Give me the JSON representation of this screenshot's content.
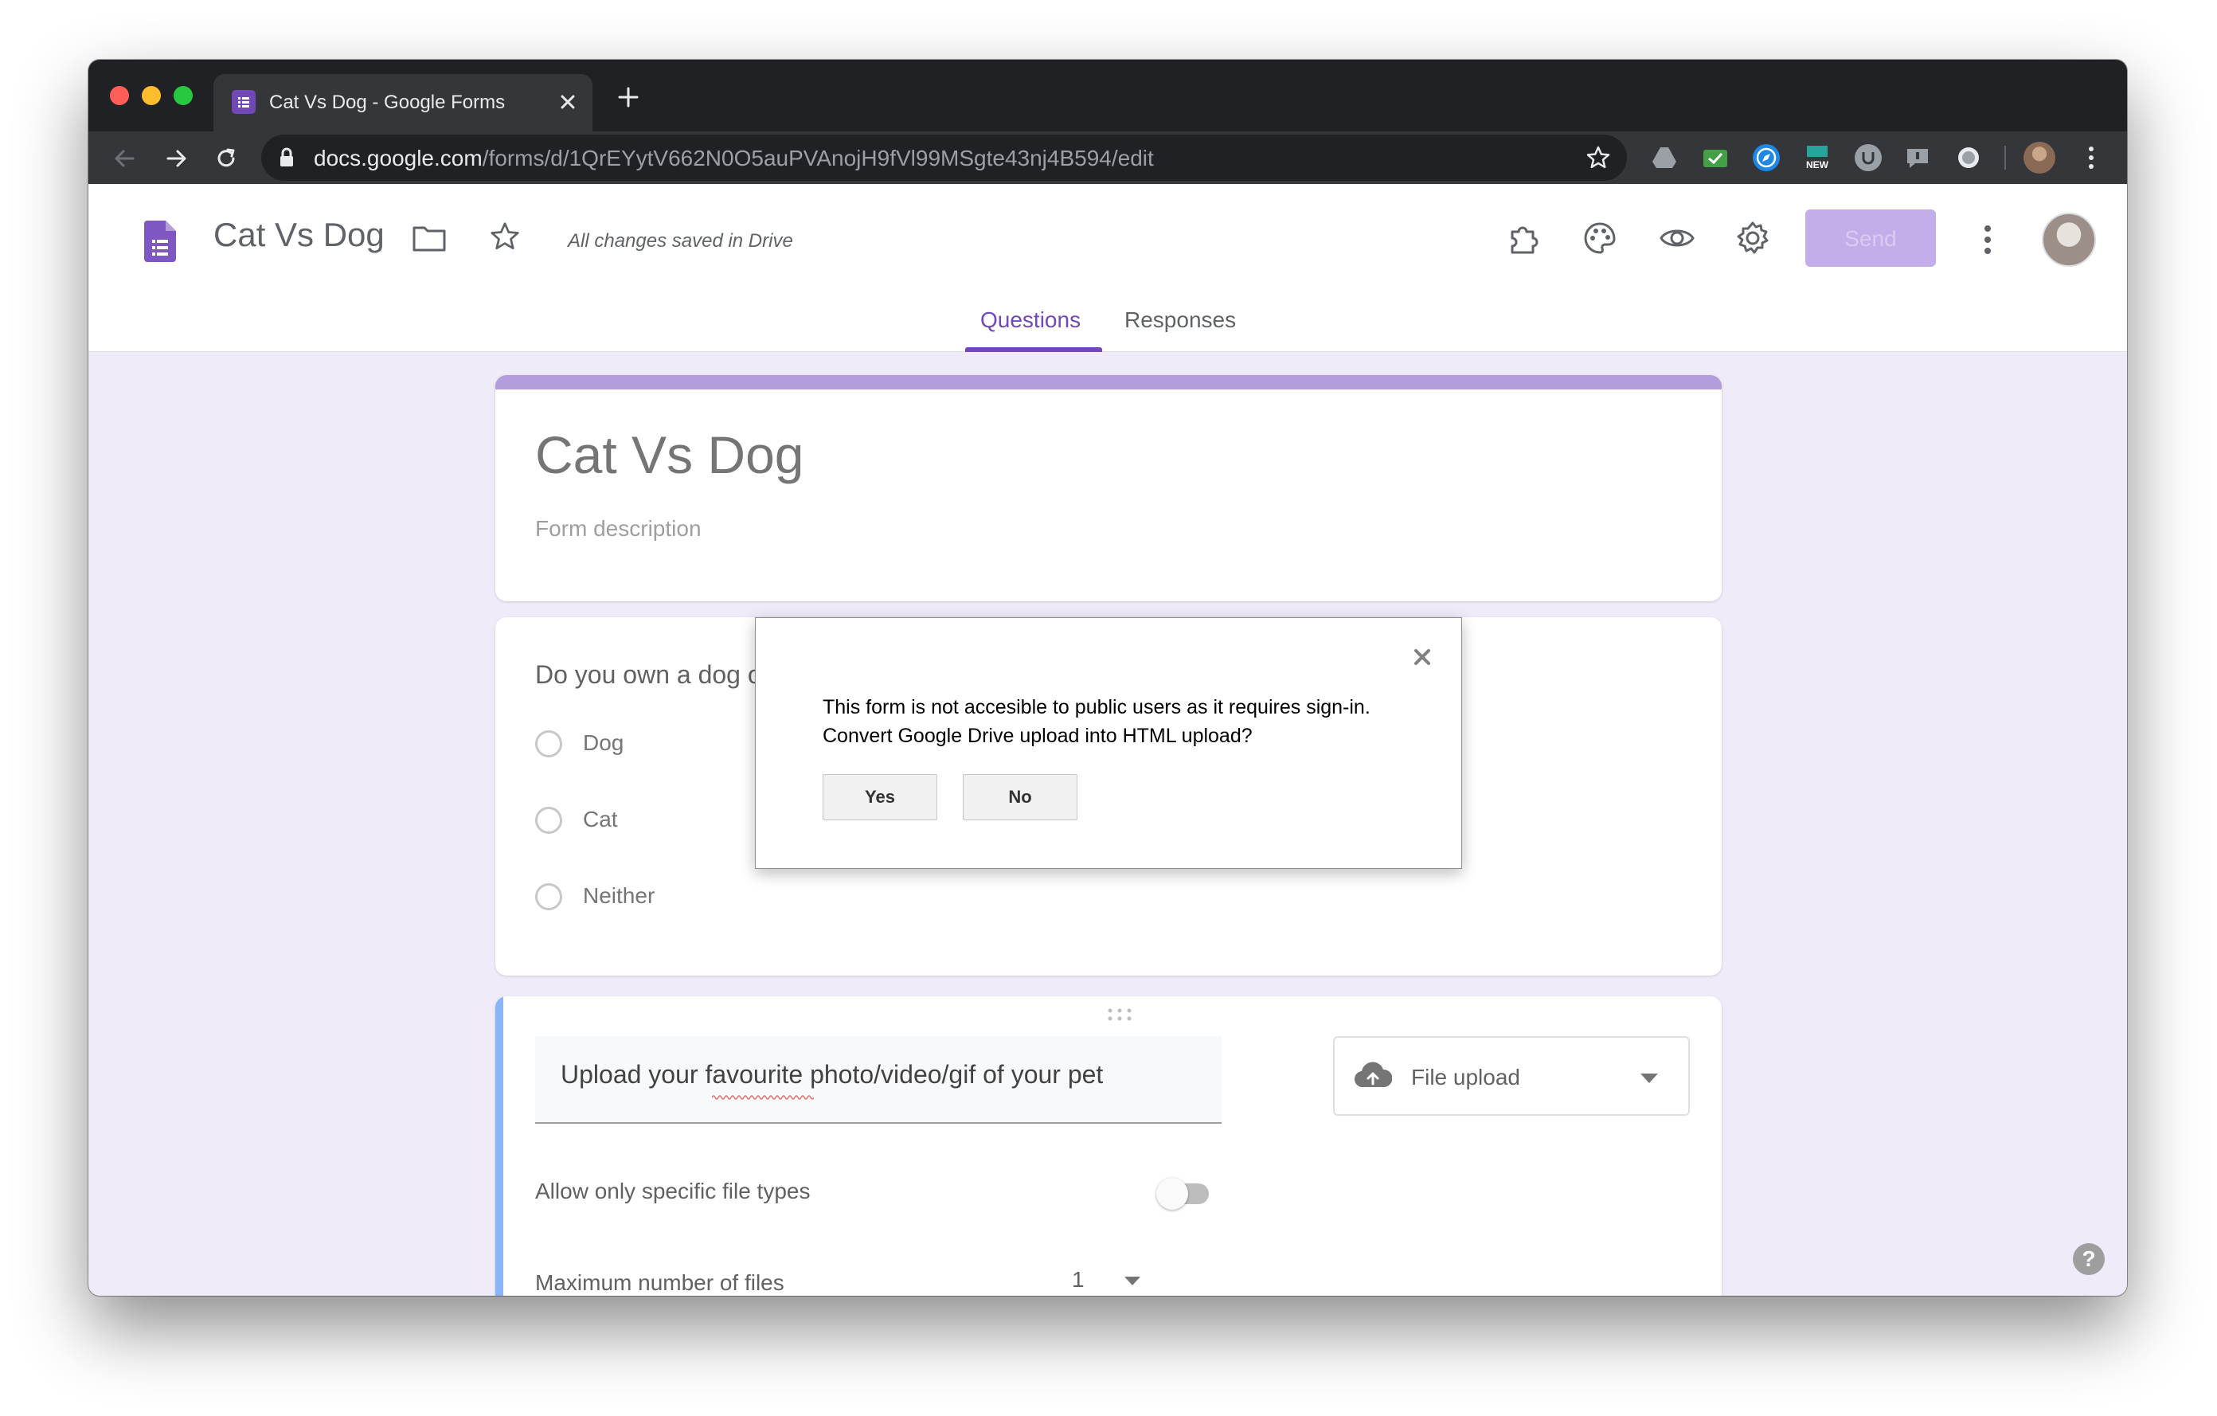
{
  "browser": {
    "tab_title": "Cat Vs Dog - Google Forms",
    "url_host": "docs.google.com",
    "url_path": "/forms/d/1QrEYytV662N0O5auPVAnojH9fVl99MSgte43nj4B594/edit",
    "extensions": [
      "google-drive-icon",
      "mail-check-icon",
      "compass-icon",
      "new-badge-icon",
      "u-extension-icon",
      "feedback-extension-icon",
      "record-extension-icon"
    ]
  },
  "header": {
    "doc_title": "Cat Vs Dog",
    "save_status": "All changes saved in Drive",
    "send_label": "Send",
    "tabs": [
      {
        "label": "Questions",
        "active": true
      },
      {
        "label": "Responses",
        "active": false
      }
    ]
  },
  "form": {
    "title": "Cat Vs Dog",
    "description_placeholder": "Form description",
    "question1": {
      "text": "Do you own a dog o",
      "options": [
        "Dog",
        "Cat",
        "Neither"
      ]
    },
    "question2": {
      "text": "Upload your favourite photo/video/gif of your pet",
      "type": "File upload",
      "allow_specific_types_label": "Allow only specific file types",
      "allow_specific_types_enabled": false,
      "max_files_label": "Maximum number of files",
      "max_files_value": "1"
    }
  },
  "dialog": {
    "line1": "This form is not accesible to public users as it requires sign-in.",
    "line2": "Convert Google Drive upload into HTML upload?",
    "yes_label": "Yes",
    "no_label": "No"
  },
  "help_label": "?",
  "colors": {
    "accent": "#7248b9",
    "accent_light": "#b39ddb",
    "send_disabled": "#c3aeea",
    "page_background": "#f0ebf8",
    "active_question_bar": "#8ab4f8"
  }
}
